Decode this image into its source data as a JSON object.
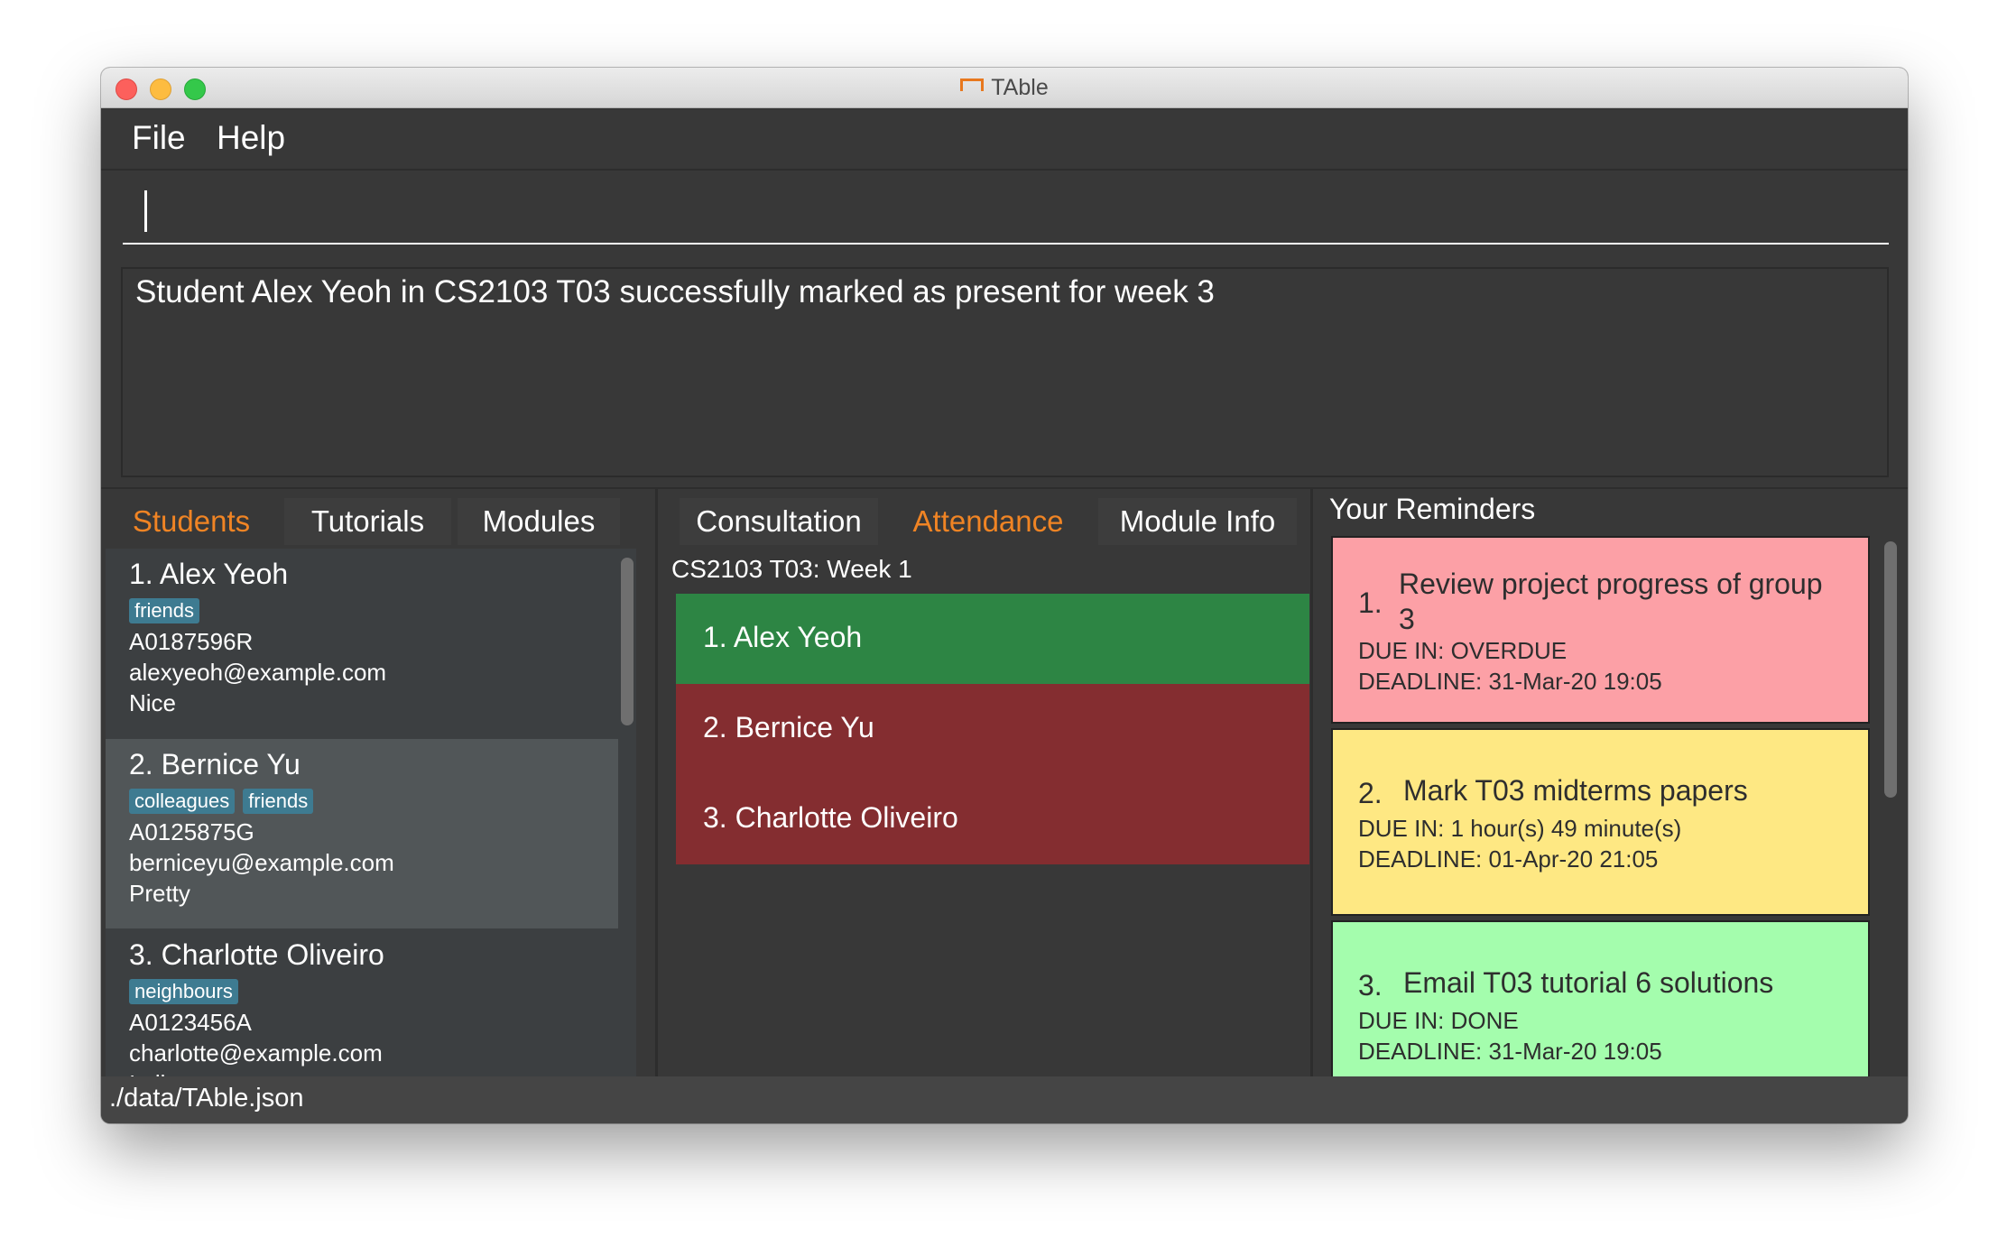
{
  "window": {
    "title": "TAble"
  },
  "menu": {
    "file": "File",
    "help": "Help"
  },
  "command": {
    "value": ""
  },
  "result": {
    "message": "Student Alex Yeoh in CS2103 T03 successfully marked as present for week 3"
  },
  "left_tabs": [
    "Students",
    "Tutorials",
    "Modules"
  ],
  "students": [
    {
      "name": "1.  Alex Yeoh",
      "tags": [
        "friends"
      ],
      "matric": "A0187596R",
      "email": "alexyeoh@example.com",
      "remark": "Nice"
    },
    {
      "name": "2.  Bernice Yu",
      "tags": [
        "colleagues",
        "friends"
      ],
      "matric": "A0125875G",
      "email": "berniceyu@example.com",
      "remark": "Pretty"
    },
    {
      "name": "3.  Charlotte Oliveiro",
      "tags": [
        "neighbours"
      ],
      "matric": "A0123456A",
      "email": "charlotte@example.com",
      "remark": "Italian"
    }
  ],
  "mid_tabs": [
    "Consultation",
    "Attendance",
    "Module Info"
  ],
  "attendance": {
    "header": "CS2103 T03: Week 1",
    "rows": [
      {
        "label": "1.  Alex Yeoh",
        "status": "present"
      },
      {
        "label": "2.  Bernice Yu",
        "status": "absent"
      },
      {
        "label": "3.  Charlotte Oliveiro",
        "status": "absent"
      }
    ]
  },
  "reminders": {
    "header": "Your Reminders",
    "items": [
      {
        "num": "1.",
        "title_1": "Review project progress of group",
        "title_2": "3",
        "due": "DUE IN: OVERDUE",
        "deadline": "DEADLINE: 31-Mar-20 19:05"
      },
      {
        "num": "2.",
        "title_1": "Mark T03 midterms papers",
        "title_2": "",
        "due": "DUE IN: 1 hour(s) 49 minute(s)",
        "deadline": "DEADLINE: 01-Apr-20 21:05"
      },
      {
        "num": "3.",
        "title_1": "Email T03 tutorial 6 solutions",
        "title_2": "",
        "due": "DUE IN: DONE",
        "deadline": "DEADLINE: 31-Mar-20 19:05"
      }
    ]
  },
  "status": {
    "path": "./data/TAble.json"
  },
  "colors": {
    "accent": "#f08424",
    "present": "#2d8544",
    "absent": "#842d30",
    "overdue": "#fca0a6",
    "pending": "#fee883",
    "done": "#a4fdad",
    "tag": "#3e7b91"
  }
}
